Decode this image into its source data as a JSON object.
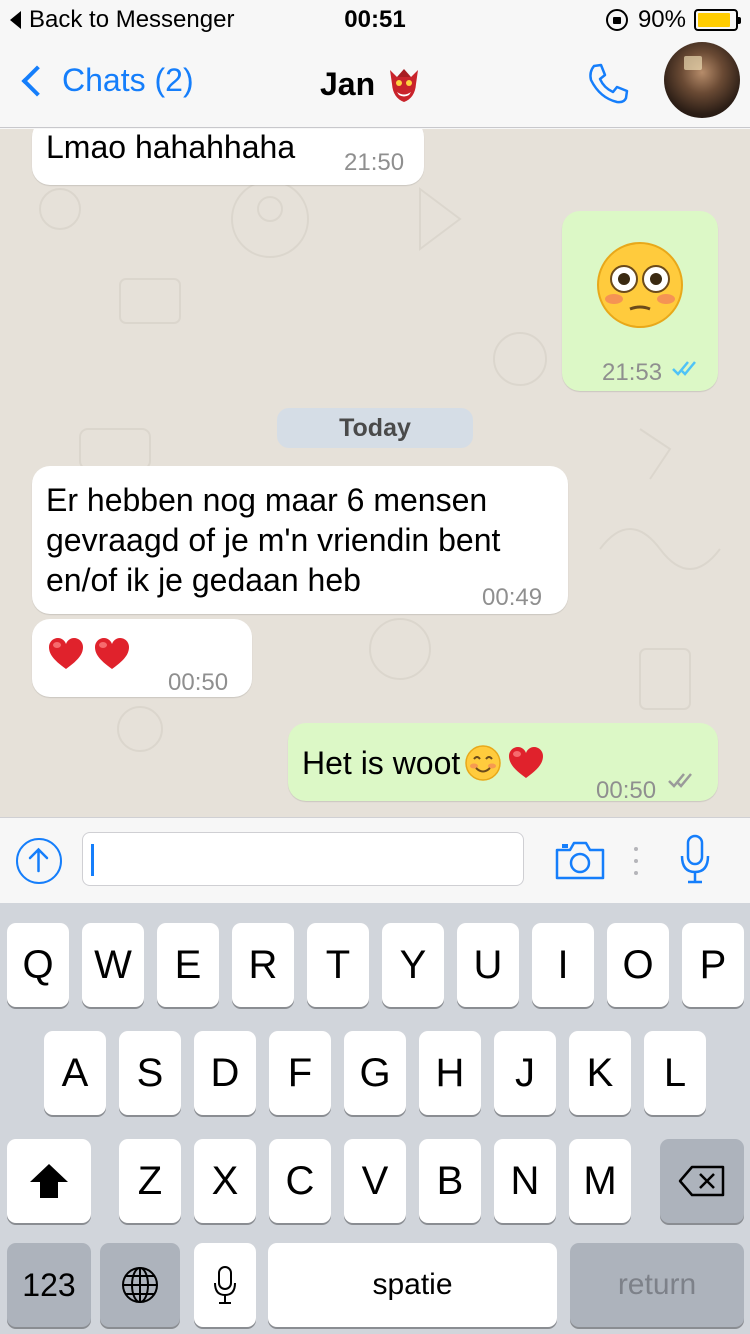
{
  "status_bar": {
    "back_label": "Back to Messenger",
    "time": "00:51",
    "battery": "90%",
    "battery_level": 0.9
  },
  "nav": {
    "back_label": "Chats (2)",
    "title": "Jan",
    "icons": [
      "chevron-left-icon",
      "goblin-mask-emoji",
      "phone-icon",
      "avatar"
    ]
  },
  "messages": [
    {
      "direction": "incoming",
      "text": "Lmao hahahhaha",
      "time": "21:50"
    },
    {
      "direction": "outgoing",
      "text": "",
      "emoji": "flushed-face-emoji",
      "time": "21:53",
      "status": "read"
    },
    {
      "direction": "incoming",
      "text": "Er hebben nog maar 6 mensen gevraagd of je m'n vriendin bent en/of ik je gedaan heb",
      "time": "00:49"
    },
    {
      "direction": "incoming",
      "text": "",
      "emoji": "two-red-hearts-emoji",
      "time": "00:50"
    },
    {
      "direction": "outgoing",
      "text": "Het is woot",
      "emoji": "smiling-face-and-red-heart-emoji",
      "time": "00:50",
      "status": "delivered"
    }
  ],
  "date_separator": "Today",
  "input": {
    "value": "",
    "placeholder": ""
  },
  "keyboard": {
    "row1": [
      "Q",
      "W",
      "E",
      "R",
      "T",
      "Y",
      "U",
      "I",
      "O",
      "P"
    ],
    "row2": [
      "A",
      "S",
      "D",
      "F",
      "G",
      "H",
      "J",
      "K",
      "L"
    ],
    "row3": [
      "Z",
      "X",
      "C",
      "V",
      "B",
      "N",
      "M"
    ],
    "numbers_key": "123",
    "space_key": "spatie",
    "return_key": "return"
  },
  "colors": {
    "accent": "#157efb",
    "outgoing_bubble": "#dcf8c6",
    "incoming_bubble": "#ffffff",
    "chat_background": "#e6e1d9",
    "read_ticks": "#4fc3f7",
    "battery": "#ffcc00"
  }
}
